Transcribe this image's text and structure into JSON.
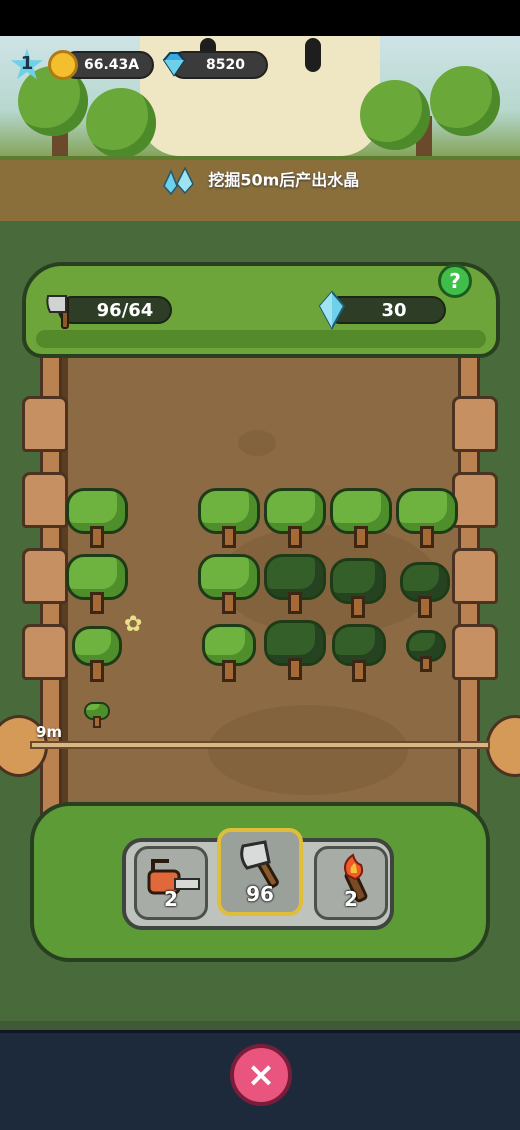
{
  "hud": {
    "level": "1",
    "coins": "66.43A",
    "gems": "8520"
  },
  "notice": {
    "text": "挖掘50m后产出水晶"
  },
  "board": {
    "axe_counter": "96/64",
    "crystal_counter": "30",
    "help_label": "?",
    "depth_label": "9m"
  },
  "tools": [
    {
      "name": "chainsaw",
      "count": "2"
    },
    {
      "name": "axe",
      "count": "96",
      "selected": true
    },
    {
      "name": "torch",
      "count": "2"
    }
  ],
  "bottom": {
    "close_icon": "×"
  },
  "colors": {
    "accent_pink": "#e9557f",
    "tree_light": "#6eb33f",
    "tree_dark": "#355f28",
    "crystal": "#6fd0ea"
  }
}
